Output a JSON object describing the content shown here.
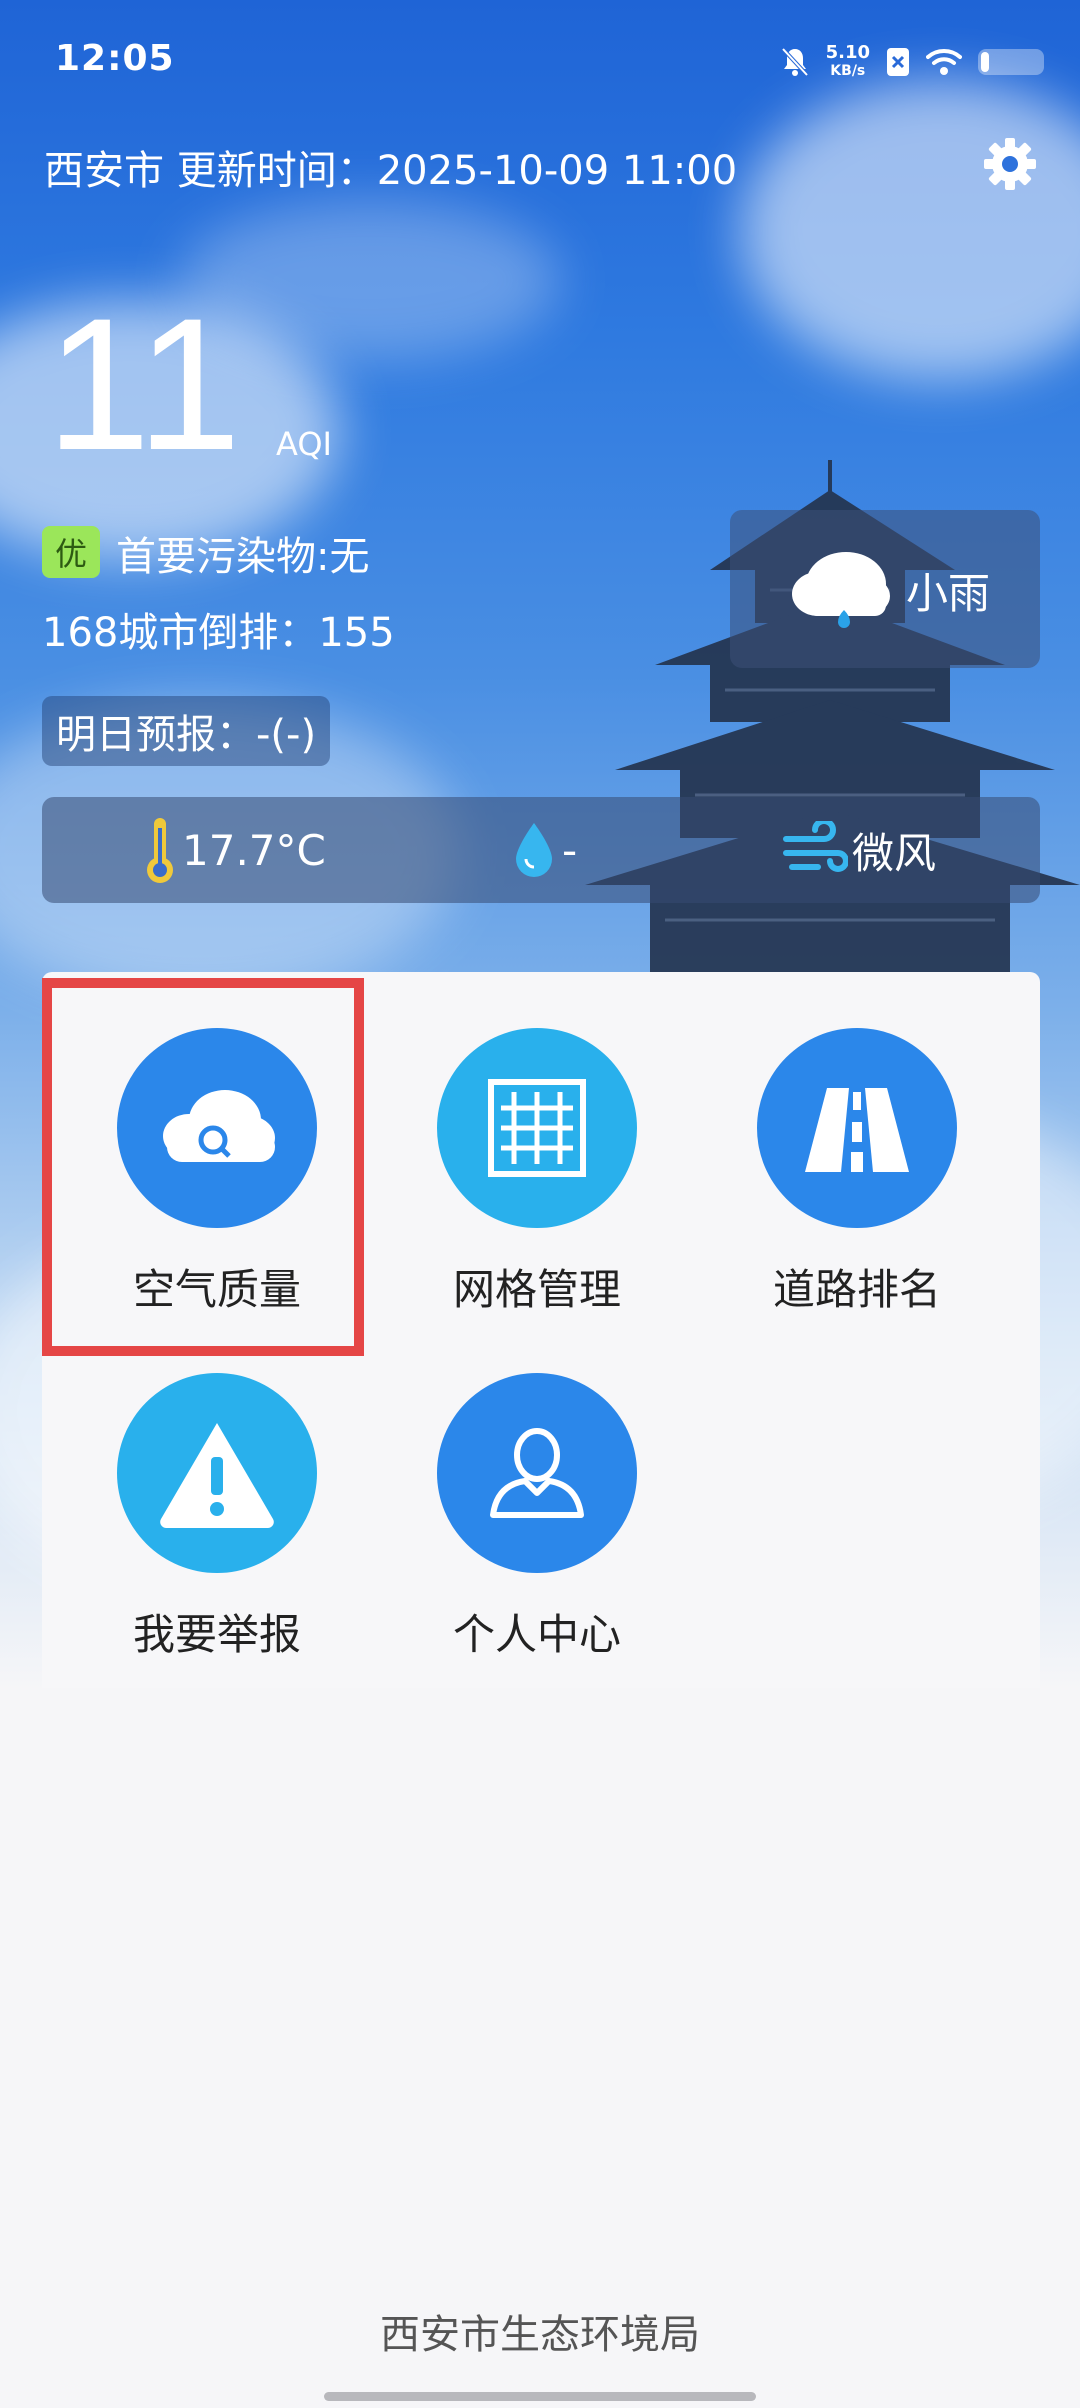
{
  "status_bar": {
    "time": "12:05",
    "net_speed_value": "5.10",
    "net_speed_unit": "KB/s",
    "icons": [
      "bell-muted-icon",
      "sim-x-icon",
      "wifi-icon",
      "battery-icon"
    ]
  },
  "header": {
    "city_update": "西安市 更新时间：2025-10-09 11:00",
    "settings_icon": "gear-icon"
  },
  "aqi": {
    "value": "11",
    "unit": "AQI",
    "quality": "优",
    "quality_color": "#9be65a",
    "primary_pollutant": "首要污染物:无",
    "rank": "168城市倒排：155",
    "forecast": "明日预报：-(-)"
  },
  "weather": {
    "icon": "cloud-rain-icon",
    "condition": "小雨",
    "temperature": "17.7°C",
    "humidity": "-",
    "wind": "微风"
  },
  "menu": {
    "items": [
      {
        "label": "空气质量",
        "icon": "cloud-search-icon",
        "color": "#2b87ea"
      },
      {
        "label": "网格管理",
        "icon": "grid-icon",
        "color": "#29b0ec"
      },
      {
        "label": "道路排名",
        "icon": "road-icon",
        "color": "#2b87ea"
      },
      {
        "label": "我要举报",
        "icon": "warning-icon",
        "color": "#29b0ec"
      },
      {
        "label": "个人中心",
        "icon": "person-icon",
        "color": "#2b87ea"
      }
    ],
    "highlight_color": "#e54646"
  },
  "footer": {
    "org": "西安市生态环境局"
  }
}
